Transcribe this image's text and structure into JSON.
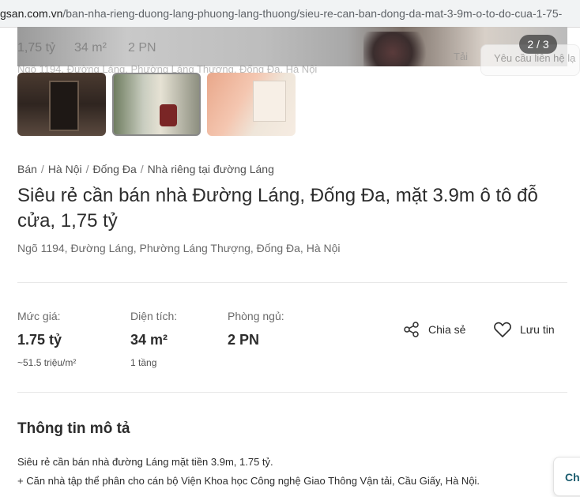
{
  "url": {
    "host": "gsan.com.vn",
    "path": "/ban-nha-rieng-duong-lang-phuong-lang-thuong/sieu-re-can-ban-dong-da-mat-3-9m-o-to-do-cua-1-75-"
  },
  "gallery": {
    "counter": "2 / 3",
    "ghost_price": "1,75 tỷ",
    "ghost_area": "34 m²",
    "ghost_rooms": "2 PN",
    "ghost_address": "Ngõ 1194, Đường Láng, Phường Láng Thượng, Đống Đa, Hà Nội",
    "ghost_tai": "Tải",
    "ghost_request": "Yêu cầu liên hệ lạ"
  },
  "breadcrumb": [
    "Bán",
    "Hà Nội",
    "Đống Đa",
    "Nhà riêng tại đường Láng"
  ],
  "title": "Siêu rẻ cần bán nhà Đường Láng, Đống Đa, mặt 3.9m ô tô đỗ cửa, 1,75 tỷ",
  "address": "Ngõ 1194, Đường Láng, Phường Láng Thượng, Đống Đa, Hà Nội",
  "stats": {
    "price": {
      "label": "Mức giá:",
      "value": "1.75 tỷ",
      "sub": "~51.5 triệu/m²"
    },
    "area": {
      "label": "Diện tích:",
      "value": "34 m²",
      "sub": "1 tầng"
    },
    "rooms": {
      "label": "Phòng ngủ:",
      "value": "2 PN"
    }
  },
  "actions": {
    "share": "Chia sẻ",
    "save": "Lưu tin"
  },
  "description": {
    "title": "Thông tin mô tả",
    "lines": [
      "Siêu rẻ cần bán nhà đường Láng mặt tiền 3.9m, 1.75 tỷ.",
      "+ Căn nhà tập thể phân cho cán bộ Viện Khoa học Công nghệ Giao Thông Vận tải, Cầu Giấy, Hà Nội."
    ]
  },
  "chat_label": "Ch"
}
